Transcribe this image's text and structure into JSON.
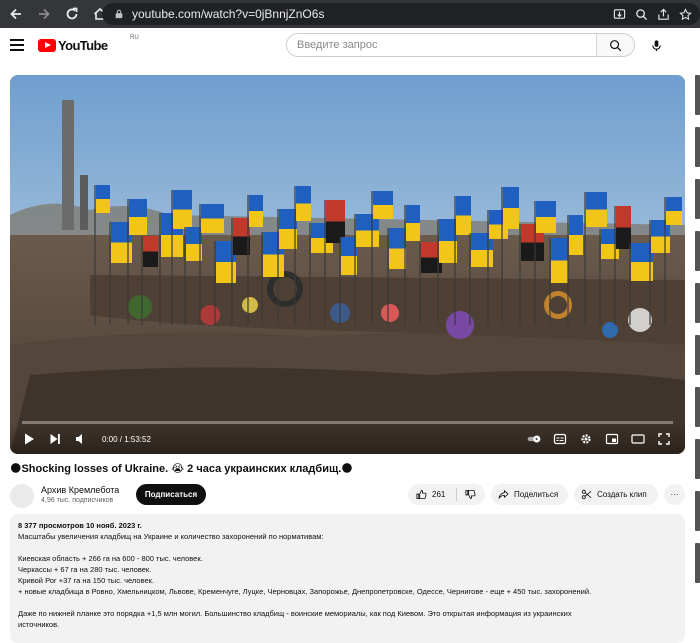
{
  "browser": {
    "url": "youtube.com/watch?v=0jBnnjZnO6s"
  },
  "header": {
    "logo_text": "YouTube",
    "logo_region": "RU",
    "search_placeholder": "Введите запрос"
  },
  "player": {
    "time": "0:00 / 1:53:52",
    "progress": 0
  },
  "video": {
    "title": "🌑Shocking losses of Ukraine. 😭 2 часа украинских кладбищ.🌑",
    "channel_name": "Архив Кремлебота",
    "subscribers": "4,96 тыс. подписчиков",
    "subscribe_label": "Подписаться",
    "likes": "261",
    "share_label": "Поделиться",
    "clip_label": "Создать клип",
    "more_label": "···"
  },
  "description": {
    "meta": "8 377 просмотров  10 нояб. 2023 г.",
    "line1": "Масштабы увеличения  кладбищ на Украине и количество захоронений по нормативам:",
    "line2": "Киевская область + 266 га на 600 - 800 тыс. человек.",
    "line3": "Черкассы + 67 га на 280 тыс. человек.",
    "line4": "Кривой Рог +37 га на 150 тыс. человек.",
    "line5": "+ новые кладбища в Ровно, Хмельницком, Львове, Кременчуге, Луцке, Черновцах, Запорожье, Днепропетровске, Одессе, Чернигове - еще + 450 тыс. захоронений.",
    "line6": "Даже по нижней планке это порядка +1,5 млн могил. Большинство кладбищ - воинские мемориалы, как под Киевом. Это открытая информация из украинских",
    "line7": "источников."
  }
}
